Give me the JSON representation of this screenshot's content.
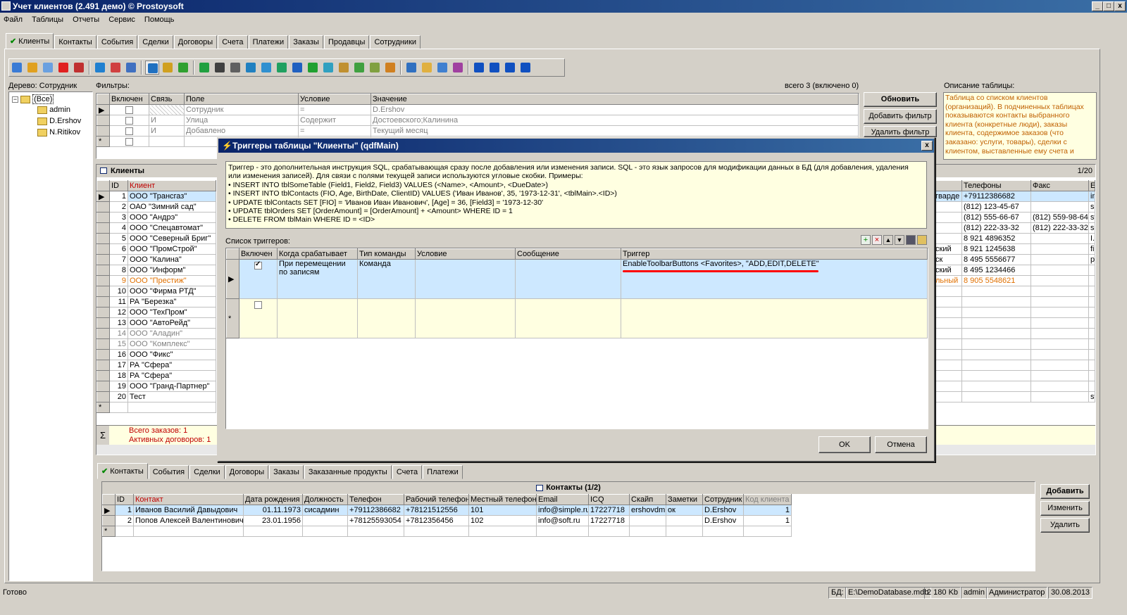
{
  "window": {
    "title": "Учет клиентов (2.491 демо) © Prostoysoft",
    "min": "_",
    "max": "□",
    "close": "x"
  },
  "menu": [
    "Файл",
    "Таблицы",
    "Отчеты",
    "Сервис",
    "Помощь"
  ],
  "main_tabs": [
    "Клиенты",
    "Контакты",
    "События",
    "Сделки",
    "Договоры",
    "Счета",
    "Платежи",
    "Заказы",
    "Продавцы",
    "Сотрудники"
  ],
  "tree": {
    "label": "Дерево: Сотрудник",
    "root": "(Все)",
    "items": [
      "admin",
      "D.Ershov",
      "N.Ritikov"
    ]
  },
  "filters": {
    "label": "Фильтры:",
    "count": "всего 3 (включено 0)",
    "columns": [
      "Включен",
      "Связь",
      "Поле",
      "Условие",
      "Значение"
    ],
    "rows": [
      {
        "link": "",
        "field": "Сотрудник",
        "cond": "=",
        "value": "D.Ershov"
      },
      {
        "link": "И",
        "field": "Улица",
        "cond": "Содержит",
        "value": "Достоевского;Калинина"
      },
      {
        "link": "И",
        "field": "Добавлено",
        "cond": "=",
        "value": "Текущий месяц"
      }
    ],
    "btn_refresh": "Обновить",
    "btn_add": "Добавить фильтр",
    "btn_delete": "Удалить фильтр"
  },
  "description": {
    "label": "Описание таблицы:",
    "text": "Таблица со списком клиентов (организаций). В подчиненных таблицах показываются контакты выбранного клиента (конкретные люди), заказы клиента, содержимое заказов (что заказано: услуги, товары), сделки с клиентом, выставленные ему счета и"
  },
  "clients": {
    "title": "Клиенты",
    "page": "1/20",
    "columns": [
      "ID",
      "Клиент"
    ],
    "rows": [
      {
        "id": "1",
        "name": "ООО \"Трансгаз\""
      },
      {
        "id": "2",
        "name": "ОАО \"Зимний сад\""
      },
      {
        "id": "3",
        "name": "ООО \"Андрэ\""
      },
      {
        "id": "4",
        "name": "ООО \"Спецавтомат\""
      },
      {
        "id": "5",
        "name": "ООО \"Северный Бриг\""
      },
      {
        "id": "6",
        "name": "ООО \"ПромСтрой\""
      },
      {
        "id": "7",
        "name": "ООО \"Калина\""
      },
      {
        "id": "8",
        "name": "ООО \"Информ\""
      },
      {
        "id": "9",
        "name": "ООО \"Престиж\""
      },
      {
        "id": "10",
        "name": "ООО \"Фирма РТД\""
      },
      {
        "id": "11",
        "name": "РА \"Березка\""
      },
      {
        "id": "12",
        "name": "ООО \"ТехПром\""
      },
      {
        "id": "13",
        "name": "ООО \"АвтоРейд\""
      },
      {
        "id": "14",
        "name": "ООО \"Аладин\""
      },
      {
        "id": "15",
        "name": "ООО \"Комплекс\""
      },
      {
        "id": "16",
        "name": "ООО \"Фикс\""
      },
      {
        "id": "17",
        "name": "РА \"Сфера\""
      },
      {
        "id": "18",
        "name": "РА \"Сфера\""
      },
      {
        "id": "19",
        "name": "ООО \"Гранд-Партнер\""
      },
      {
        "id": "20",
        "name": "Тест"
      }
    ],
    "totals": [
      "Всего заказов: 1",
      "Активных договоров: 1"
    ],
    "right_columns": [
      "Телефоны",
      "Факс",
      "E"
    ],
    "right_rows": [
      {
        "addr": "гварде",
        "phone": "+79112386682",
        "fax": "",
        "e": "in"
      },
      {
        "addr": "",
        "phone": "(812) 123-45-67",
        "fax": "",
        "e": "sa"
      },
      {
        "addr": "",
        "phone": "(812) 555-66-67",
        "fax": "(812) 559-98-64",
        "e": "sv"
      },
      {
        "addr": "",
        "phone": "(812) 222-33-32",
        "fax": "(812) 222-33-32",
        "e": "s"
      },
      {
        "addr": "",
        "phone": "8 921 4896352",
        "fax": "",
        "e": "I.F"
      },
      {
        "addr": "ский",
        "phone": "8 921 1245638",
        "fax": "",
        "e": "fir"
      },
      {
        "addr": "ск",
        "phone": "8 495 5556677",
        "fax": "",
        "e": "ps"
      },
      {
        "addr": "ский",
        "phone": "8 495 1234466",
        "fax": "",
        "e": ""
      },
      {
        "addr": "льный",
        "phone": "8 905 5548621",
        "fax": "",
        "e": ""
      }
    ],
    "row20_e": "sv"
  },
  "dialog": {
    "title": "Триггеры таблицы \"Клиенты\" (qdfMain)",
    "close": "x",
    "help": [
      "Триггер - это дополнительная инструкция SQL, срабатывающая сразу после добавления или изменения записи. SQL - это язык запросов для модификации данных в БД (для добавления, удаления",
      "или изменения записей). Для связи с полями текущей записи используются угловые скобки. Примеры:",
      "• INSERT INTO tblSomeTable (Field1, Field2, Field3) VALUES (<Name>, <Amount>, <DueDate>)",
      "• INSERT INTO tblContacts (FIO, Age, BirthDate, ClientID) VALUES ('Иван Иванов', 35, '1973-12-31', <tblMain>.<ID>)",
      "• UPDATE tblContacts SET [FIO] = 'Иванов Иван Иванович', [Age] = 36, [Field3] = '1973-12-30'",
      "• UPDATE tblOrders SET [OrderAmount] = [OrderAmount] + <Amount> WHERE ID = 1",
      "• DELETE FROM tblMain WHERE ID = <ID>"
    ],
    "list_label": "Список триггеров:",
    "columns": [
      "Включен",
      "Когда срабатывает",
      "Тип команды",
      "Условие",
      "Сообщение",
      "Триггер"
    ],
    "trigger": {
      "when": "При перемещении по записям",
      "type": "Команда",
      "cond": "",
      "msg": "",
      "code": "EnableToolbarButtons <Favorites>, \"ADD,EDIT,DELETE\""
    },
    "ok": "OK",
    "cancel": "Отмена",
    "underline_color": "#ff0000"
  },
  "bottom_tabs": [
    "Контакты",
    "События",
    "Сделки",
    "Договоры",
    "Заказы",
    "Заказанные продукты",
    "Счета",
    "Платежи"
  ],
  "contacts": {
    "title": "Контакты (1/2)",
    "columns": [
      "ID",
      "Контакт",
      "Дата рождения",
      "Должность",
      "Телефон",
      "Рабочий телефон",
      "Местный телефон",
      "Email",
      "ICQ",
      "Скайп",
      "Заметки",
      "Сотрудник",
      "Код клиента"
    ],
    "rows": [
      [
        "1",
        "Иванов Василий Давыдович",
        "01.11.1973",
        "сисадмин",
        "+79112386682",
        "+78121512556",
        "101",
        "info@simple.ru",
        "17227718",
        "ershovdmitriy",
        "ок",
        "D.Ershov",
        "1"
      ],
      [
        "2",
        "Попов Алексей Валентинович",
        "23.01.1956",
        "",
        "+78125593054",
        "+7812356456",
        "102",
        "info@soft.ru",
        "17227718",
        "",
        "",
        "D.Ershov",
        "1"
      ]
    ],
    "btn_add": "Добавить",
    "btn_edit": "Изменить",
    "btn_delete": "Удалить"
  },
  "status": {
    "ready": "Готово",
    "db_label": "БД:",
    "db_path": "E:\\DemoDatabase.mdb",
    "size": "2 180 Kb",
    "user": "admin",
    "role": "Администратор",
    "date": "30.08.2013"
  }
}
